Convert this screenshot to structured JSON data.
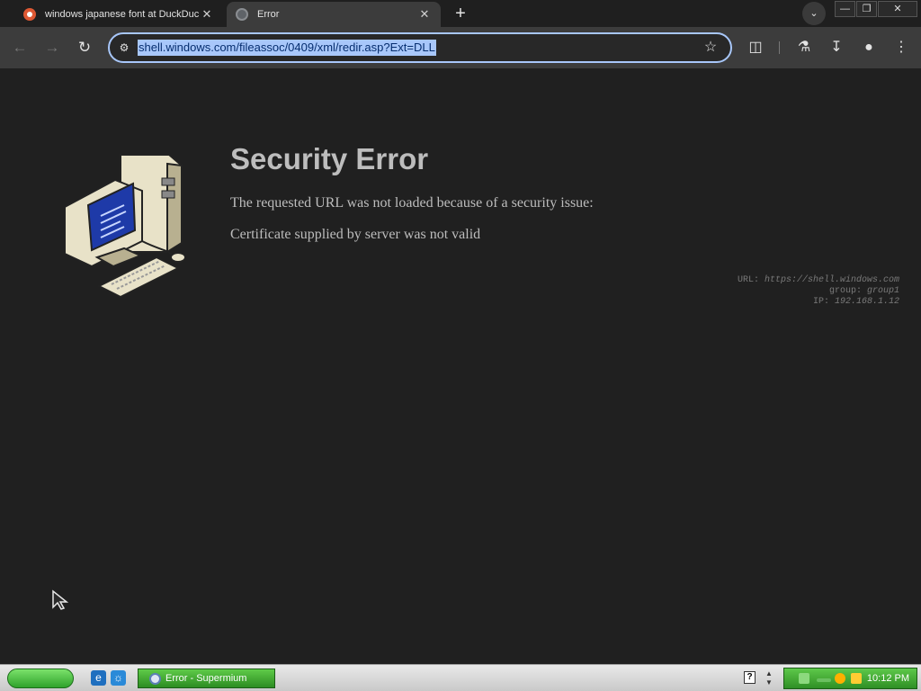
{
  "browser": {
    "tabs": [
      {
        "title": "windows japanese font at DuckDuc",
        "icon": "duckduckgo-icon",
        "active": false
      },
      {
        "title": "Error",
        "icon": "globe-icon",
        "active": true
      }
    ],
    "address_bar": {
      "url": "shell.windows.com/fileassoc/0409/xml/redir.asp?Ext=DLL",
      "selected": true
    },
    "accent_color": "#a8c7fa"
  },
  "error_page": {
    "title": "Security Error",
    "message": "The requested URL was not loaded because of a security issue:",
    "reason": "Certificate supplied by server was not valid",
    "meta": {
      "url_label": "URL:",
      "url_value": "https://shell.windows.com",
      "group_label": "group:",
      "group_value": "group1",
      "ip_label": "IP:",
      "ip_value": "192.168.1.12"
    }
  },
  "taskbar": {
    "task_button": "Error - Supermium",
    "help_glyph": "?",
    "clock": "10:12 PM",
    "accent_color": "#3ca82e"
  }
}
